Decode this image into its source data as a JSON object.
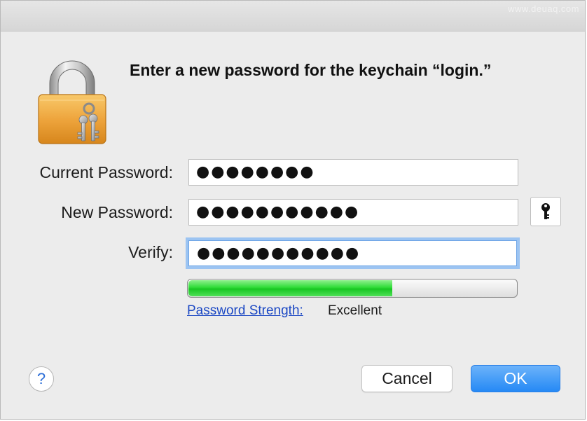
{
  "dialog": {
    "heading": "Enter a new password for the keychain “login.”",
    "watermark": "www.deuaq.com",
    "lock_icon": "keychain-lock-icon"
  },
  "fields": {
    "current_password": {
      "label": "Current Password:",
      "value": "●●●●●●●●"
    },
    "new_password": {
      "label": "New Password:",
      "value": "●●●●●●●●●●●"
    },
    "verify": {
      "label": "Verify:",
      "value": "●●●●●●●●●●●"
    }
  },
  "key_button": {
    "icon": "key-icon"
  },
  "strength": {
    "fraction": 0.62,
    "link_label": "Password Strength:",
    "value": "Excellent",
    "fill_color": "#2fdb38"
  },
  "buttons": {
    "help": "?",
    "cancel": "Cancel",
    "ok": "OK"
  },
  "colors": {
    "accent": "#2589f5",
    "focus_ring": "#9cc4f2",
    "link": "#1d49c4"
  }
}
